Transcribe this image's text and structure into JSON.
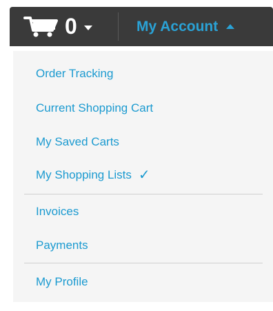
{
  "header": {
    "cart_count": "0",
    "account_label": "My Account"
  },
  "menu": {
    "items": [
      {
        "label": "Order Tracking"
      },
      {
        "label": "Current Shopping Cart"
      },
      {
        "label": "My Saved Carts"
      },
      {
        "label": "My Shopping Lists",
        "checked": true
      },
      {
        "label": "Invoices"
      },
      {
        "label": "Payments"
      },
      {
        "label": "My Profile"
      }
    ]
  },
  "colors": {
    "header_bg": "#3a3a3a",
    "accent": "#1b9ad0",
    "menu_bg": "#f5f5f5"
  }
}
